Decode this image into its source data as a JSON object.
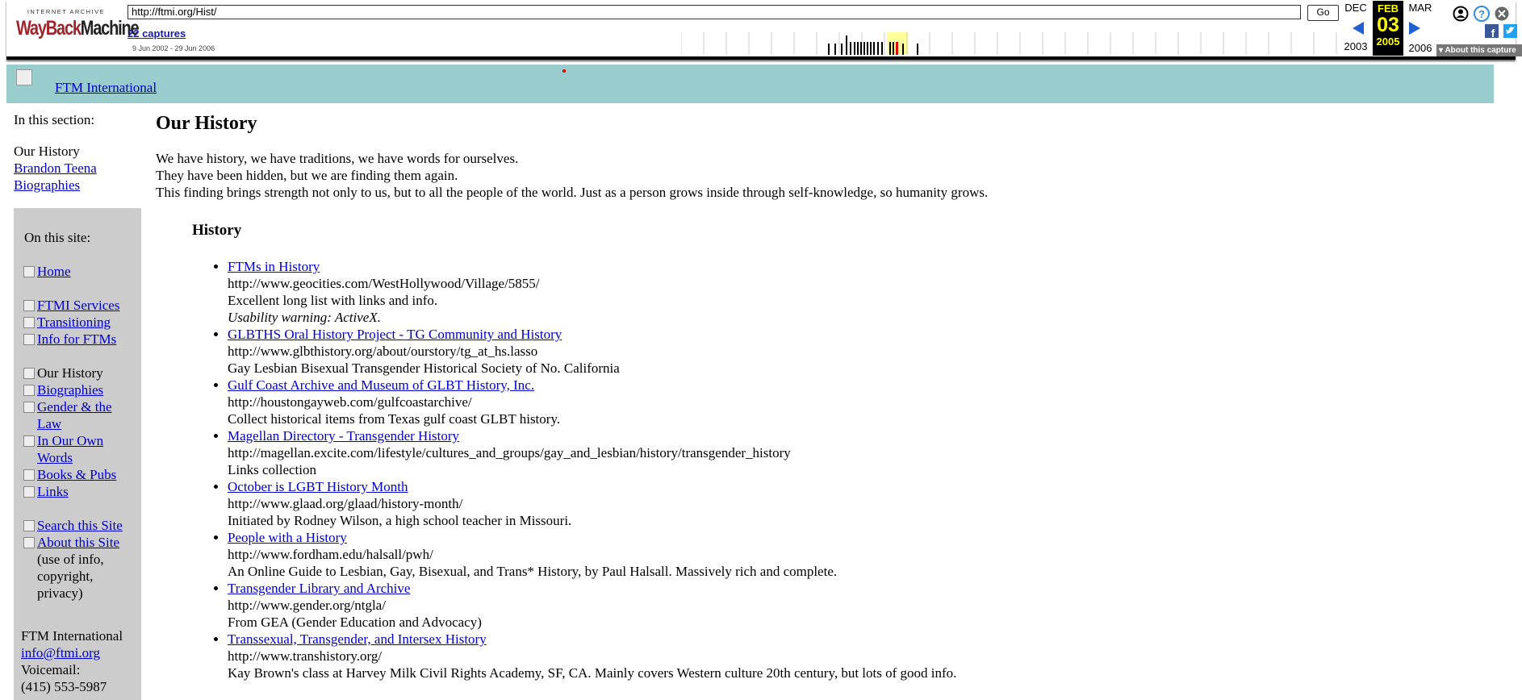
{
  "toolbar": {
    "logo_top": "INTERNET ARCHIVE",
    "logo_way": "WayBack",
    "logo_machine": "Machine",
    "url": "http://ftmi.org/Hist/",
    "go_label": "Go",
    "captures": "22 captures",
    "range": "9 Jun 2002 - 29 Jun 2006",
    "prev_month": "DEC",
    "cur_month": "FEB",
    "next_month": "MAR",
    "cur_day": "03",
    "prev_year": "2003",
    "cur_year": "2005",
    "next_year": "2006",
    "about_capture": "About this capture",
    "icons": [
      "account-icon",
      "help-icon",
      "close-icon",
      "facebook-icon",
      "twitter-icon"
    ]
  },
  "site": {
    "title_link": "FTM International"
  },
  "section": {
    "heading": "In this section:",
    "current": "Our History",
    "links": [
      "Brandon Teena",
      "Biographies"
    ]
  },
  "sidebar": {
    "heading": "On this site:",
    "items": [
      {
        "label": "Home",
        "link": true
      },
      {
        "label": "FTMI Services",
        "link": true
      },
      {
        "label": "Transitioning",
        "link": true
      },
      {
        "label": "Info for FTMs",
        "link": true
      },
      {
        "label": "Our History",
        "link": false
      },
      {
        "label": "Biographies",
        "link": true
      },
      {
        "label": "Gender & the Law",
        "link": true
      },
      {
        "label": "In Our Own Words",
        "link": true
      },
      {
        "label": "Books & Pubs",
        "link": true
      },
      {
        "label": "Links",
        "link": true
      },
      {
        "label": "Search this Site",
        "link": true
      },
      {
        "label": "About this Site",
        "link": true
      }
    ],
    "about_note": "(use of info, copyright, privacy)",
    "org_name": "FTM International",
    "email": "info@ftmi.org",
    "voicemail_label": "Voicemail:",
    "phone": "(415) 553-5987"
  },
  "main": {
    "title": "Our History",
    "intro": [
      "We have history, we have traditions, we have words for ourselves.",
      "They have been hidden, but we are finding them again.",
      "This finding brings strength not only to us, but to all the people of the world. Just as a person grows inside through self-knowledge, so humanity grows."
    ],
    "section_title": "History",
    "entries": [
      {
        "title": "FTMs in History",
        "url": "http://www.geocities.com/WestHollywood/Village/5855/",
        "desc": "Excellent long list with links and info.",
        "note": "Usability warning: ActiveX."
      },
      {
        "title": "GLBTHS Oral History Project - TG Community and History",
        "url": "http://www.glbthistory.org/about/ourstory/tg_at_hs.lasso",
        "desc": "Gay Lesbian Bisexual Transgender Historical Society of No. California"
      },
      {
        "title": "Gulf Coast Archive and Museum of GLBT History, Inc.",
        "url": "http://houstongayweb.com/gulfcoastarchive/",
        "desc": "Collect historical items from Texas gulf coast GLBT history."
      },
      {
        "title": "Magellan Directory - Transgender History",
        "url": "http://magellan.excite.com/lifestyle/cultures_and_groups/gay_and_lesbian/history/transgender_history",
        "desc": "Links collection"
      },
      {
        "title": "October is LGBT History Month",
        "url": "http://www.glaad.org/glaad/history-month/",
        "desc": "Initiated by Rodney Wilson, a high school teacher in Missouri."
      },
      {
        "title": "People with a History",
        "url": "http://www.fordham.edu/halsall/pwh/",
        "desc": "An Online Guide to Lesbian, Gay, Bisexual, and Trans* History, by Paul Halsall. Massively rich and complete."
      },
      {
        "title": "Transgender Library and Archive",
        "url": "http://www.gender.org/ntgla/",
        "desc": "From GEA (Gender Education and Advocacy)"
      },
      {
        "title": "Transsexual, Transgender, and Intersex History",
        "url": "http://www.transhistory.org/",
        "desc": "Kay Brown's class at Harvey Milk Civil Rights Academy, SF, CA. Mainly covers Western culture 20th century, but lots of good info."
      }
    ]
  }
}
